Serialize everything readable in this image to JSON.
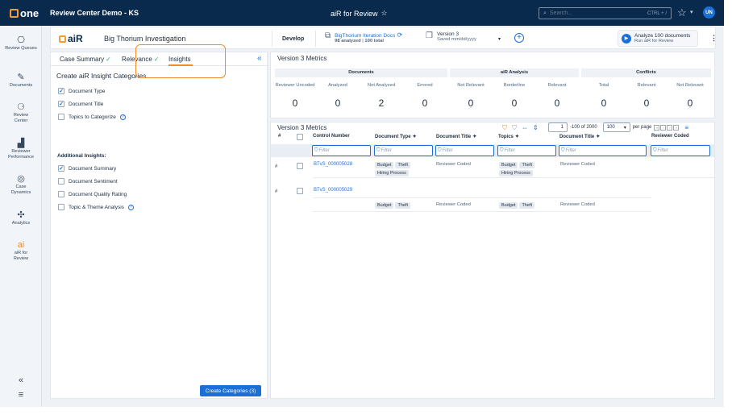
{
  "topbar": {
    "logo": "one",
    "workspace_title": "Review Center Demo - KS",
    "center_title": "aiR for Review",
    "search_placeholder": "Search...",
    "search_shortcut": "CTRL + /",
    "avatar": "UN"
  },
  "sidebar": {
    "items": [
      {
        "label": "Review Queues",
        "icon": "review-queues-icon"
      },
      {
        "label": "Documents",
        "icon": "documents-icon"
      },
      {
        "label": "Review Center",
        "icon": "review-center-icon"
      },
      {
        "label": "Reviewer Performance",
        "icon": "reviewer-performance-icon"
      },
      {
        "label": "Case Dynamics",
        "icon": "case-dynamics-icon"
      },
      {
        "label": "Analytics",
        "icon": "analytics-icon"
      },
      {
        "label": "aiR for Review",
        "icon": "air-icon"
      }
    ]
  },
  "subheader": {
    "air_logo": "aiR",
    "project": "Big Thorium Investigation",
    "mode": "Develop",
    "docs_title": "BigThorium Iteration Docs",
    "docs_analyzed": "98 analyzed",
    "docs_total": "100 total",
    "version_title": "Version 3",
    "version_saved": "Saved mm/dd/yyyy",
    "analyze_title": "Analyze 100 documents",
    "analyze_sub": "Run aiR for Review"
  },
  "left_panel": {
    "tabs": [
      "Case Summary",
      "Relevance",
      "Insights"
    ],
    "heading": "Create aiR Insight Categories",
    "categories": [
      {
        "label": "Document Type",
        "checked": true
      },
      {
        "label": "Document Title",
        "checked": true
      },
      {
        "label": "Topics to Categorize",
        "checked": false
      }
    ],
    "additional_heading": "Additional Insights:",
    "additional": [
      {
        "label": "Document Summary",
        "checked": true
      },
      {
        "label": "Document Sentiment",
        "checked": false
      },
      {
        "label": "Document Quality Rating",
        "checked": false
      },
      {
        "label": "Topic & Theme Analysis",
        "checked": false
      }
    ],
    "create_button": "Create Categories (3)"
  },
  "metrics": {
    "title": "Version 3 Metrics",
    "groups": [
      "Documents",
      "aiR Analysis",
      "Conflicts"
    ],
    "cells": [
      {
        "label": "Reviewer Uncoded",
        "value": "0"
      },
      {
        "label": "Analyzed",
        "value": "0"
      },
      {
        "label": "Not Analyzed",
        "value": "2"
      },
      {
        "label": "Errored",
        "value": "0"
      },
      {
        "label": "Not Relevant",
        "value": "0"
      },
      {
        "label": "Borderline",
        "value": "0"
      },
      {
        "label": "Relevant",
        "value": "0"
      },
      {
        "label": "Total",
        "value": "0"
      },
      {
        "label": "Relevant",
        "value": "0"
      },
      {
        "label": "Not Relevant",
        "value": "0"
      }
    ]
  },
  "grid": {
    "title": "Version 3 Metrics",
    "page_value": "1",
    "range_text": "-100 of 2000",
    "page_size": "100",
    "per_page": "per page",
    "columns": [
      "#",
      "Control Number",
      "Document Type",
      "Document Title",
      "Topics",
      "Document Title",
      "Reviewer Coded"
    ],
    "filter_placeholder": "Filter",
    "rows": [
      {
        "num": "#",
        "control": "BTvS_000005028",
        "doc_type": [
          "Budget",
          "Theft",
          "Hiring Process"
        ],
        "doc_title": "Reviewer Coded",
        "topics": [
          "Budget",
          "Theft",
          "Hiring Process"
        ],
        "doc_title2": "Reviewer Coded"
      },
      {
        "num": "#",
        "control": "BTvS_000005029",
        "doc_type": [
          "Budget",
          "Theft"
        ],
        "doc_title": "Reviewer Coded",
        "topics": [
          "Budget",
          "Theft"
        ],
        "doc_title2": "Reviewer Coded"
      }
    ]
  }
}
